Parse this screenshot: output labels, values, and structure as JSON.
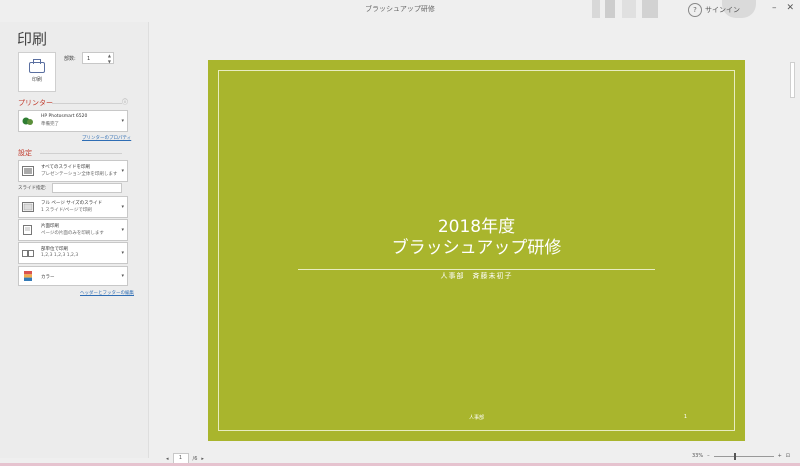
{
  "window": {
    "title": "ブラッシュアップ研修",
    "signin": "サインイン",
    "min": "–",
    "max": "☐",
    "close": "✕",
    "help": "?"
  },
  "left": {
    "heading": "印刷",
    "print_button": "印刷",
    "copies_label": "部数:",
    "copies_value": "1",
    "printer_section": "プリンター",
    "printer_name": "HP Photosmart 6520",
    "printer_status": "準備完了",
    "printer_props_link": "プリンターのプロパティ",
    "settings_section": "設定",
    "print_all_line1": "すべてのスライドを印刷",
    "print_all_line2": "プレゼンテーション全体を印刷します",
    "slides_label": "スライド指定:",
    "slides_value": "",
    "layout_line1": "フル ページ サイズのスライド",
    "layout_line2": "1 スライド/ページで印刷",
    "sides_line1": "片面印刷",
    "sides_line2": "ページの片面のみを印刷します",
    "collate_line1": "部単位で印刷",
    "collate_line2": "1,2,3 1,2,3 1,2,3",
    "color_label": "カラー",
    "header_footer_link": "ヘッダーとフッターの編集",
    "info_icon": "ⓘ"
  },
  "slide": {
    "title_line1": "2018年度",
    "title_line2": "ブラッシュアップ研修",
    "subtitle": "人事部　斉藤未初子",
    "footer": "人事部",
    "page_number": "1"
  },
  "bottom": {
    "page_current": "1",
    "page_total": "/6",
    "prev": "◂",
    "next": "▸",
    "zoom_percent": "33%",
    "zoom_minus": "–",
    "zoom_plus": "+",
    "fit_icon": "⊡"
  },
  "colors": {
    "slide_bg": "#a9b52d",
    "section_red": "#c0392b",
    "link_blue": "#2e6db4"
  }
}
